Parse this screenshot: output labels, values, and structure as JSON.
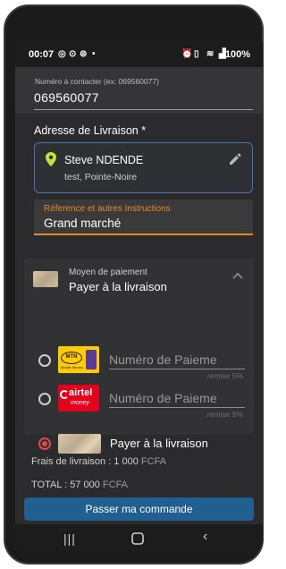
{
  "status_bar": {
    "time": "00:07",
    "battery": "100%"
  },
  "contact": {
    "label": "Numéro à contacter (ex: 069560077)",
    "value": "069560077"
  },
  "delivery": {
    "title": "Adresse de Livraison *",
    "name": "Steve NDENDE",
    "address": "test, Pointe-Noire"
  },
  "instructions": {
    "label": "Réference et autres Instructions",
    "value": "Grand marché"
  },
  "payment": {
    "header_label": "Moyen de paiement",
    "header_value": "Payer à la livraison",
    "options": [
      {
        "logo": "MTN",
        "logo_sub": "Mobile Money",
        "placeholder": "Numéro de Paieme",
        "remise": "remise 5%",
        "selected": false
      },
      {
        "logo": "airtel",
        "logo_sub": "money",
        "placeholder": "Numéro de Paieme",
        "remise": "remise 5%",
        "selected": false
      },
      {
        "label": "Payer à la livraison",
        "selected": true
      }
    ]
  },
  "fees": {
    "label": "Frais de livraison : 1 000",
    "unit": "FCFA"
  },
  "total": {
    "label": "TOTAL : 57 000",
    "unit": "FCFA"
  },
  "order_button": "Passer ma commande",
  "colors": {
    "accent": "#e2892c",
    "button": "#205f8f",
    "radio_selected": "#e04b4b",
    "card_border": "#4d6db4",
    "pin": "#c7e23a"
  }
}
